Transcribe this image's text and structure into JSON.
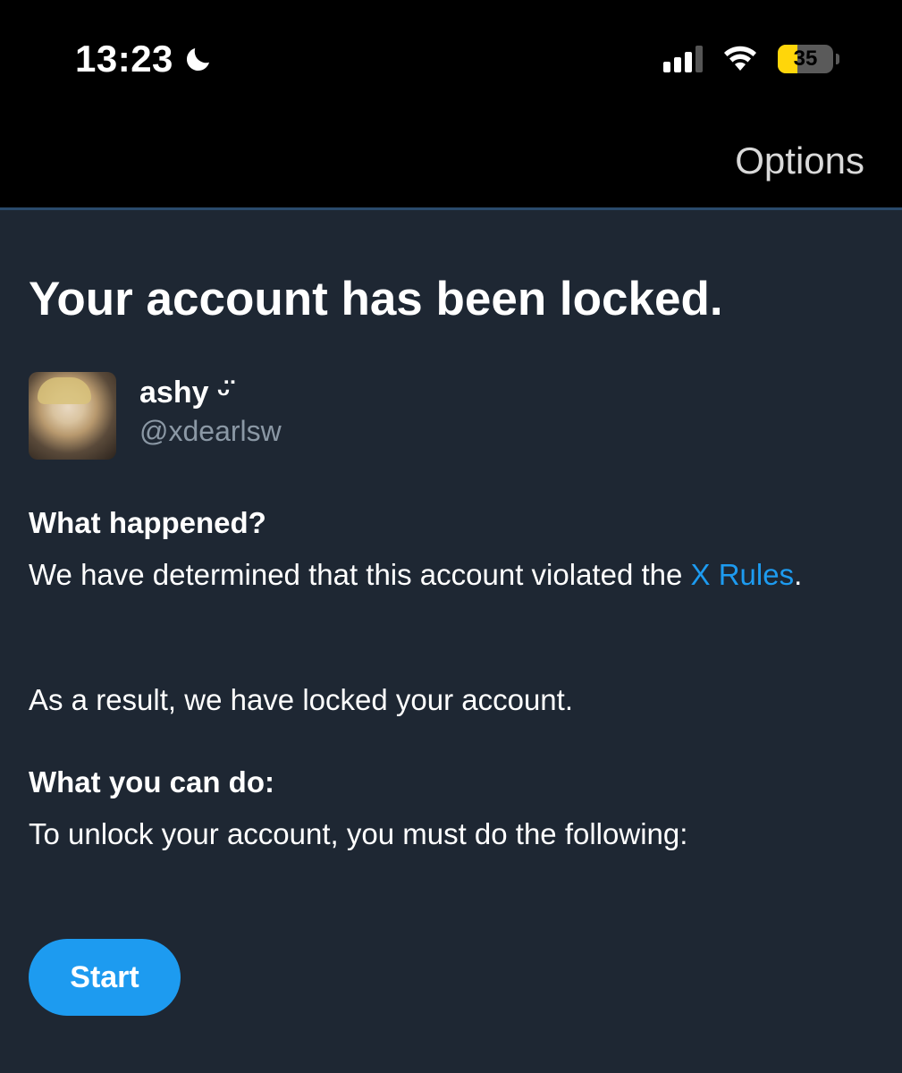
{
  "status_bar": {
    "time": "13:23",
    "battery_level": "35",
    "battery_fraction": 0.35,
    "icons": [
      "moon-icon",
      "signal-icon",
      "wifi-icon",
      "battery-icon"
    ]
  },
  "nav": {
    "options_label": "Options"
  },
  "page": {
    "title": "Your account has been locked."
  },
  "profile": {
    "display_name": "ashy ᵕ̈",
    "handle": "@xdearlsw"
  },
  "what_happened": {
    "title": "What happened?",
    "text_before_link": "We have determined that this account violated the ",
    "link_text": "X Rules",
    "text_after_link": ".",
    "result_text": "As a result, we have locked your account."
  },
  "what_you_can_do": {
    "title": "What you can do:",
    "text": "To unlock your account, you must do the following:"
  },
  "actions": {
    "start_label": "Start"
  },
  "colors": {
    "background": "#1e2733",
    "accent": "#1d9bf0",
    "secondary_text": "#8b98a5"
  }
}
